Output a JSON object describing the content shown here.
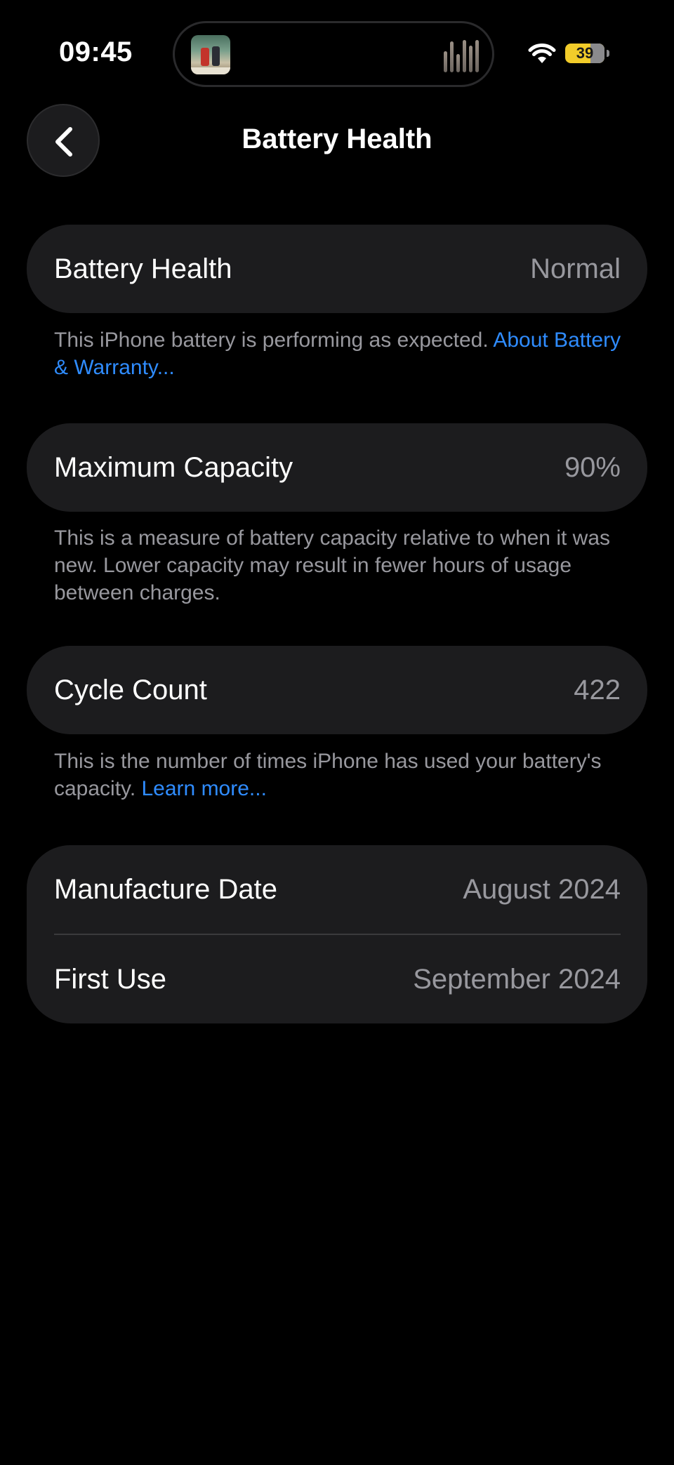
{
  "status_bar": {
    "time": "09:45",
    "battery_level": "39",
    "icons": [
      "now-playing-artwork-icon",
      "audio-waveform-icon",
      "wifi-icon",
      "battery-icon"
    ]
  },
  "nav": {
    "back_icon": "chevron-left-icon",
    "title": "Battery Health"
  },
  "sections": {
    "health": {
      "label": "Battery Health",
      "value": "Normal",
      "footnote_text": "This iPhone battery is performing as expected. ",
      "footnote_link": "About Battery & Warranty..."
    },
    "capacity": {
      "label": "Maximum Capacity",
      "value": "90%",
      "footnote_text": "This is a measure of battery capacity relative to when it was new. Lower capacity may result in fewer hours of usage between charges."
    },
    "cycles": {
      "label": "Cycle Count",
      "value": "422",
      "footnote_text": "This is the number of times iPhone has used your battery's capacity. ",
      "footnote_link": "Learn more..."
    },
    "dates": {
      "manufacture_label": "Manufacture Date",
      "manufacture_value": "August 2024",
      "first_use_label": "First Use",
      "first_use_value": "September 2024"
    }
  },
  "colors": {
    "background": "#000000",
    "card": "#1c1c1e",
    "secondary_text": "#98989e",
    "link": "#2f8cff",
    "battery_fill": "#f2cc2a"
  }
}
